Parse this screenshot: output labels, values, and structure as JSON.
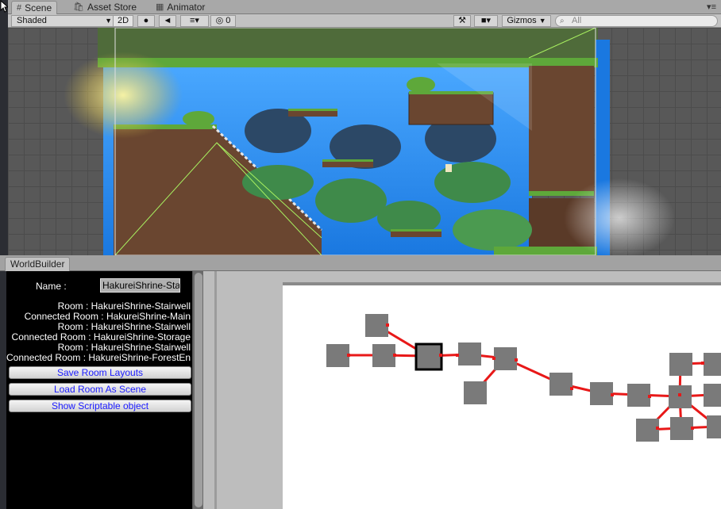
{
  "tabs": [
    {
      "label": "Scene",
      "icon": "grid-icon",
      "active": true
    },
    {
      "label": "Asset Store",
      "icon": "store-icon",
      "active": false
    },
    {
      "label": "Animator",
      "icon": "animator-icon",
      "active": false
    }
  ],
  "toolbar": {
    "shading_mode": "Shaded",
    "mode_2d": "2D",
    "hidden_count": "0",
    "gizmos": "Gizmos",
    "search_placeholder": "All"
  },
  "world_builder": {
    "tab_label": "WorldBuilder",
    "name_label": "Name :",
    "name_value": "HakureiShrine-Stairwell",
    "room_lines": [
      "Room : HakureiShrine-Stairwell",
      "Connected Room : HakureiShrine-Main",
      "Room : HakureiShrine-Stairwell",
      "Connected Room : HakureiShrine-Storage",
      "Room : HakureiShrine-Stairwell",
      "Connected Room : HakureiShrine-ForestEntrance"
    ],
    "buttons": {
      "save": "Save Room Layouts",
      "load": "Load Room As Scene",
      "show": "Show Scriptable object"
    }
  },
  "colors": {
    "node": "#7a7a7a",
    "edge": "#e81818",
    "selected_border": "#000000",
    "sky": "#1f8cf0",
    "grass": "#5ea83a",
    "dirt": "#6a4630"
  }
}
